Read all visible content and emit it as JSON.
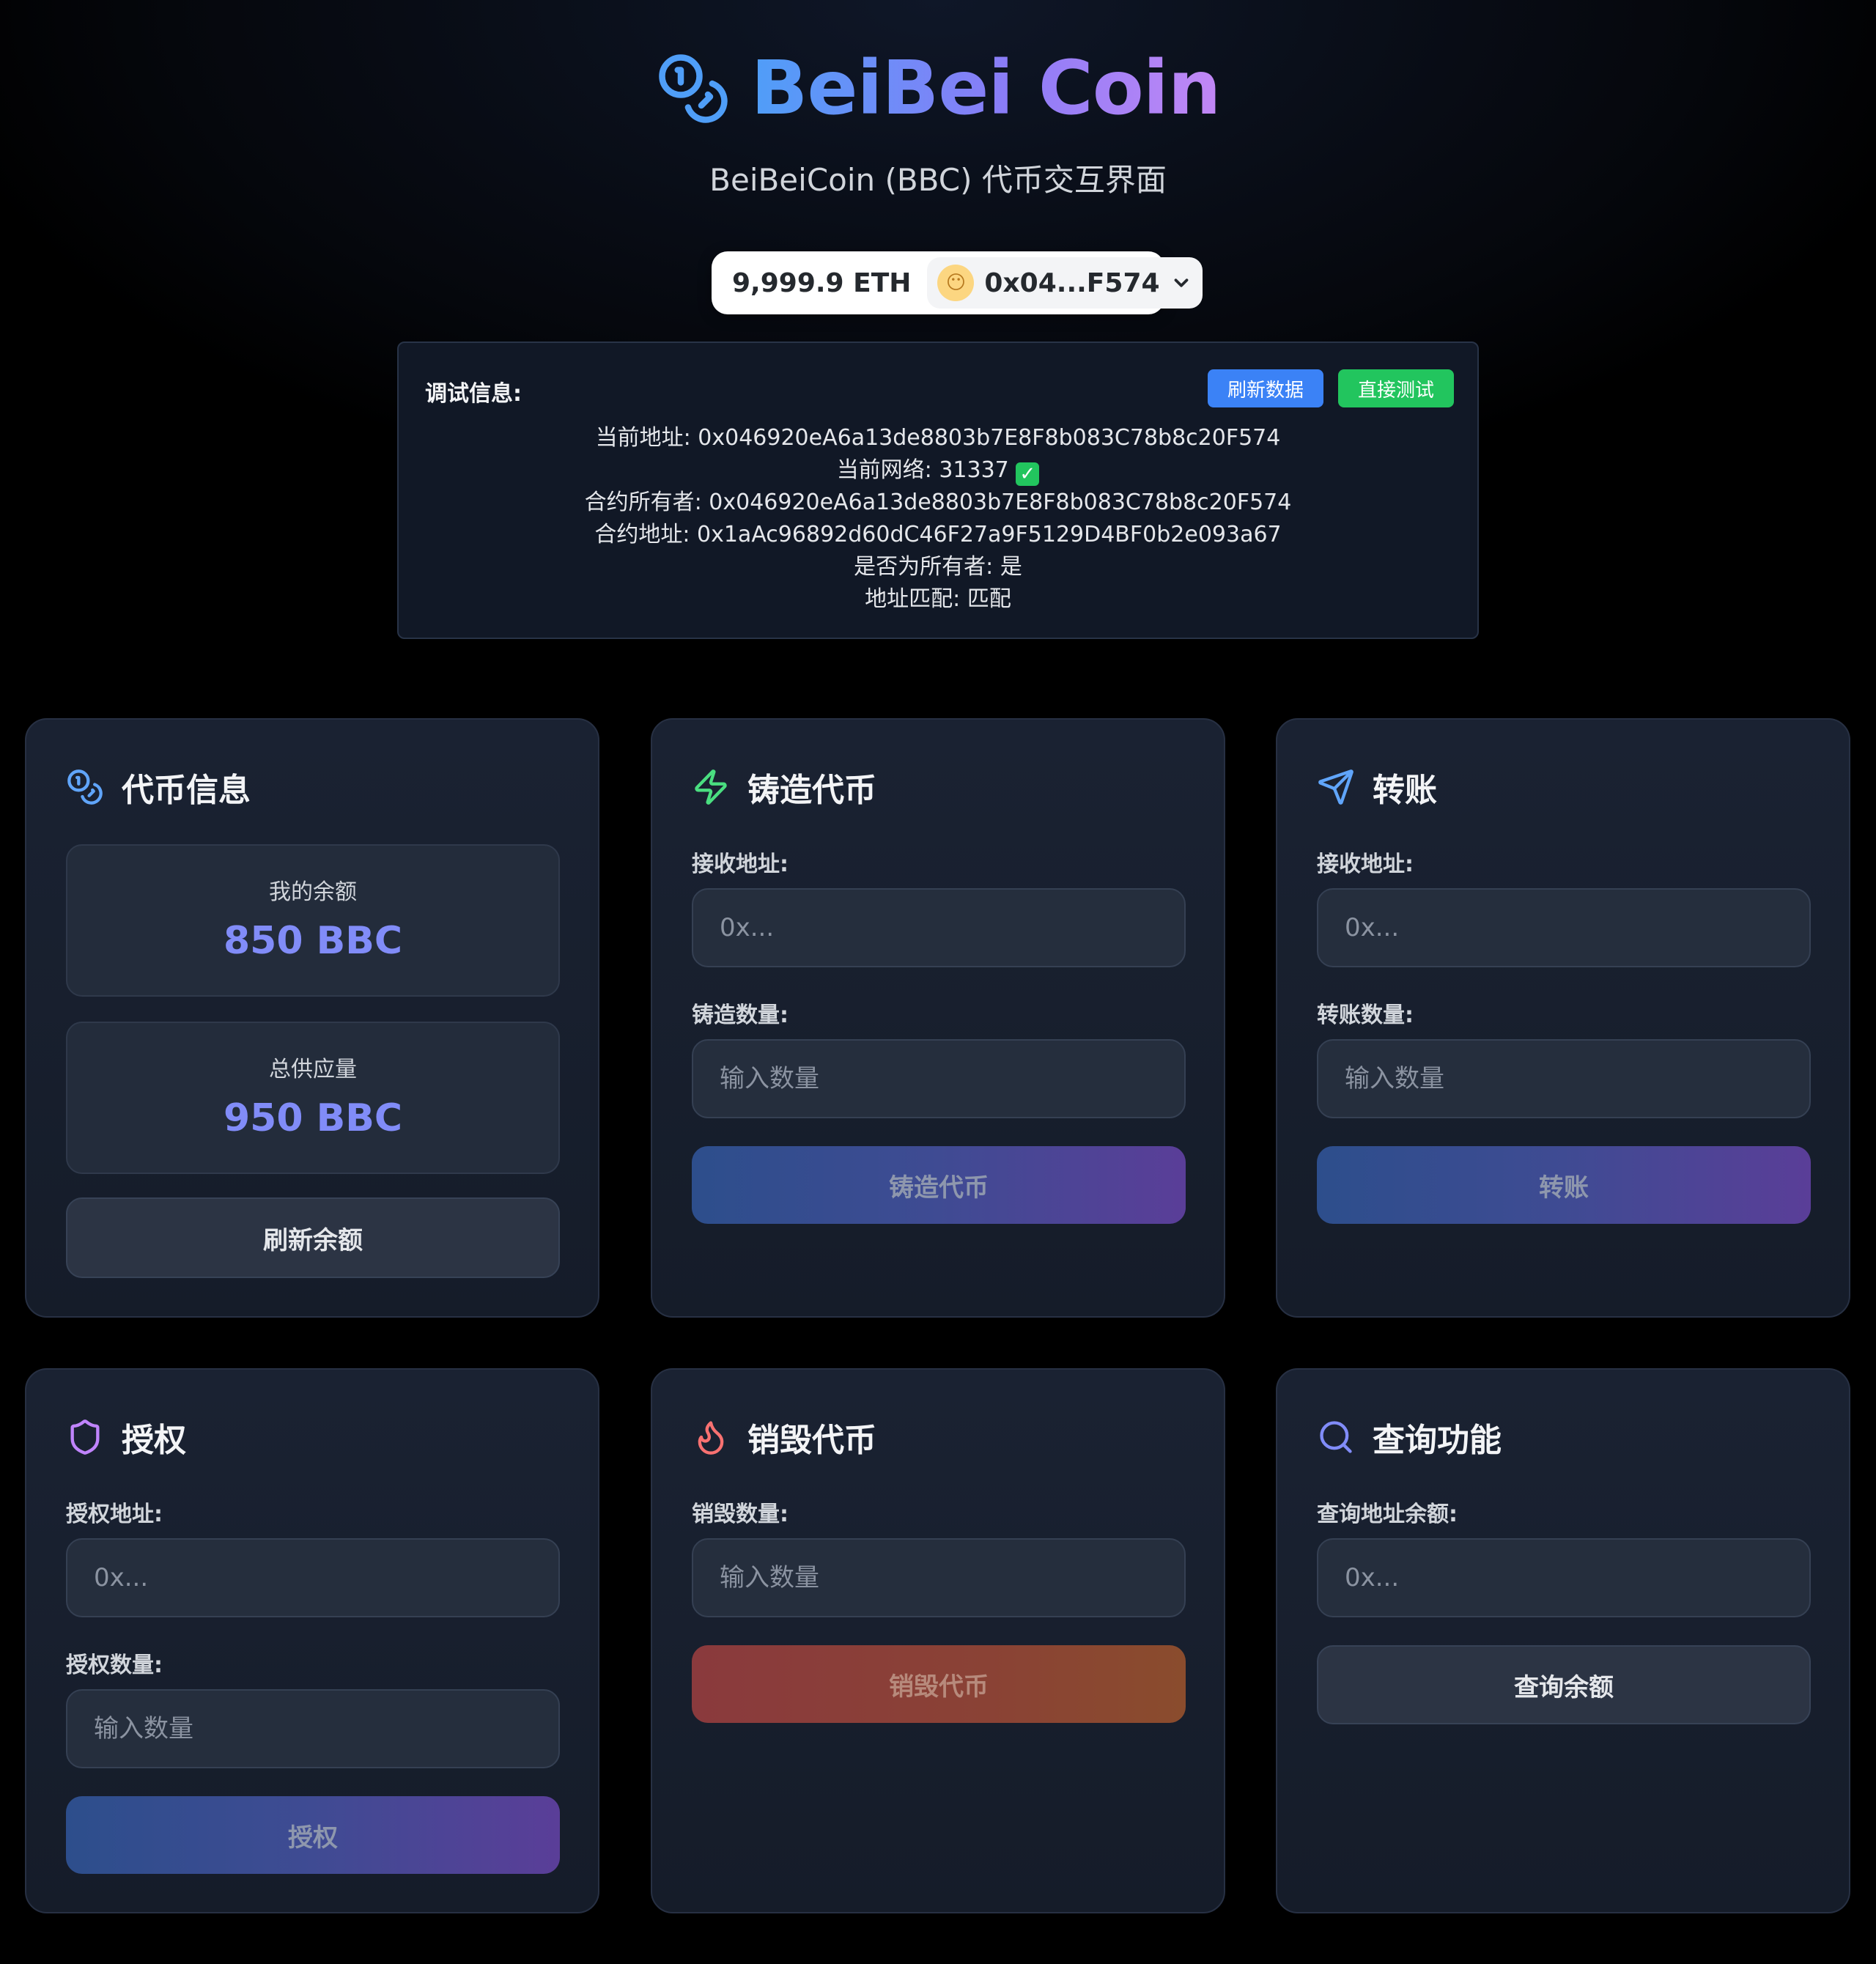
{
  "header": {
    "title": "BeiBei Coin",
    "subtitle": "BeiBeiCoin (BBC) 代币交互界面",
    "logo_icon": "coins-icon"
  },
  "wallet": {
    "balance": "9,999.9 ETH",
    "address": "0x04...F574",
    "avatar_emoji": "😶"
  },
  "debug": {
    "title": "调试信息:",
    "refresh_label": "刷新数据",
    "test_label": "直接测试",
    "current_address": "当前地址: 0x046920eA6a13de8803b7E8F8b083C78b8c20F574",
    "current_network": "当前网络: 31337",
    "contract_owner": "合约所有者: 0x046920eA6a13de8803b7E8F8b083C78b8c20F574",
    "contract_address": "合约地址: 0x1aAc96892d60dC46F27a9F5129D4BF0b2e093a67",
    "is_owner": "是否为所有者: 是",
    "address_match": "地址匹配: 匹配",
    "check_mark": "✓"
  },
  "token_info": {
    "title": "代币信息",
    "my_balance_label": "我的余额",
    "my_balance_value": "850 BBC",
    "total_supply_label": "总供应量",
    "total_supply_value": "950 BBC",
    "refresh_button": "刷新余额"
  },
  "mint": {
    "title": "铸造代币",
    "address_label": "接收地址:",
    "address_placeholder": "0x...",
    "amount_label": "铸造数量:",
    "amount_placeholder": "输入数量",
    "button": "铸造代币"
  },
  "transfer": {
    "title": "转账",
    "address_label": "接收地址:",
    "address_placeholder": "0x...",
    "amount_label": "转账数量:",
    "amount_placeholder": "输入数量",
    "button": "转账"
  },
  "approve": {
    "title": "授权",
    "address_label": "授权地址:",
    "address_placeholder": "0x...",
    "amount_label": "授权数量:",
    "amount_placeholder": "输入数量",
    "button": "授权"
  },
  "burn": {
    "title": "销毁代币",
    "amount_label": "销毁数量:",
    "amount_placeholder": "输入数量",
    "button": "销毁代币"
  },
  "query": {
    "title": "查询功能",
    "address_label": "查询地址余额:",
    "address_placeholder": "0x...",
    "button": "查询余额"
  },
  "colors": {
    "title_gradient_start": "#4f9ef8",
    "title_gradient_end": "#c287f5",
    "refresh_blue": "#3b82f6",
    "test_green": "#22c55e",
    "stat_value": "#818cf8",
    "mint_icon": "#4ade80",
    "transfer_icon": "#60a5fa",
    "approve_icon": "#c084fc",
    "burn_icon": "#f87171",
    "query_icon": "#818cf8"
  }
}
